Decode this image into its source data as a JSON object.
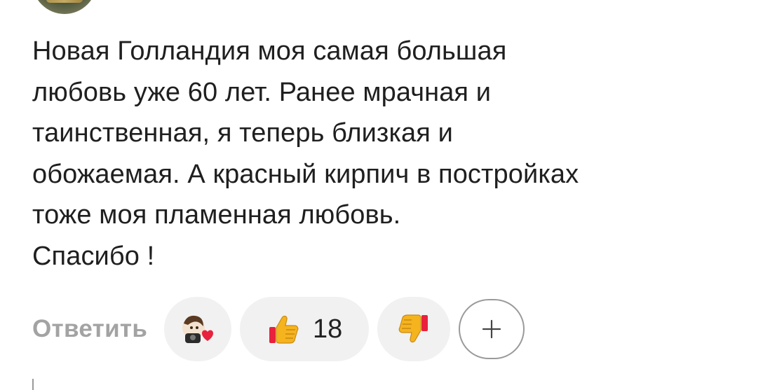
{
  "comment": {
    "lines": [
      "Новая Голландия моя самая большая",
      "любовь уже 60 лет. Ранее мрачная и",
      "таинственная, я теперь близкая и",
      "обожаемая. А красный кирпич в постройках",
      "тоже моя пламенная любовь.",
      "Спасибо !"
    ]
  },
  "actions": {
    "reply_label": "Ответить",
    "like_count": "18"
  },
  "icons": {
    "avatar": "user-avatar",
    "reactors": "reactor-avatar-heart-icon",
    "like": "thumbs-up-icon",
    "dislike": "thumbs-down-icon",
    "add_reaction": "plus-icon"
  },
  "colors": {
    "text": "#1f1f1f",
    "muted": "#a3a3a3",
    "pill_bg": "#f1f1f1",
    "heart": "#e8213d",
    "thumb": "#f5b31e"
  }
}
